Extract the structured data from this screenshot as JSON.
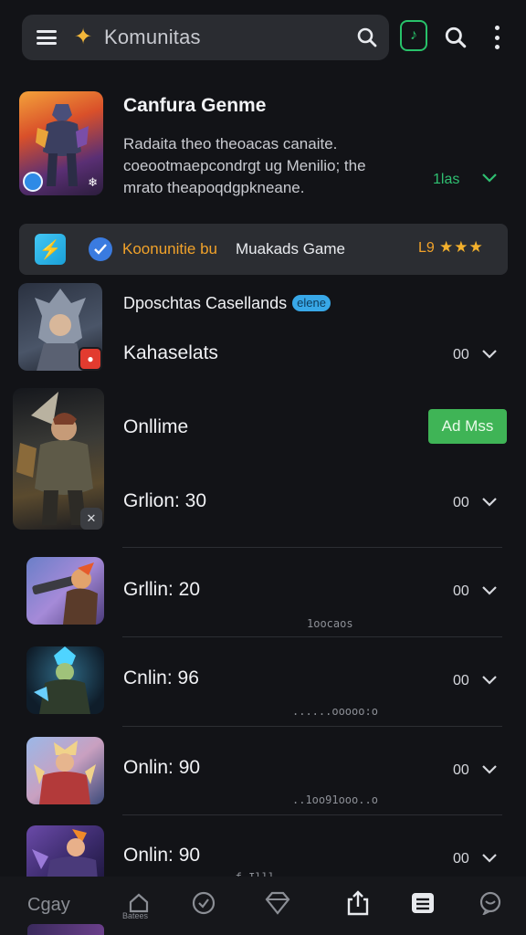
{
  "header": {
    "menu_icon": "hamburger-icon",
    "logo_icon": "star-logo-icon",
    "title": "Komunitas",
    "icons": [
      "search-icon",
      "music-note-icon",
      "search-icon",
      "more-vertical-icon"
    ]
  },
  "featured": {
    "title": "Canfura Genme",
    "description": "Radaita theo theoacas canaite. coeootmaepcondrgt ug Menilio; the mrato theapoqdgpkneane.",
    "meta": "1las"
  },
  "banner": {
    "highlight": "Koonunitie bu",
    "text": "Muakads Game",
    "rating": "L9",
    "stars": "★★★"
  },
  "rows": [
    {
      "title": "Dposchtas Casellands",
      "tag": "elene",
      "label": "Kahaselats",
      "count": "00"
    },
    {
      "title": "Onllime",
      "action": "Ad Mss",
      "label": "Grlion: 30",
      "count": "00"
    },
    {
      "label": "Grllin: 20",
      "count": "00",
      "sub": "1oocaos"
    },
    {
      "label": "Cnlin: 96",
      "count": "00",
      "sub": "......ooooo:o"
    },
    {
      "label": "Onlin: 90",
      "count": "00",
      "sub": "..1oo91ooo..o"
    },
    {
      "label": "Onlin: 90",
      "count": "00",
      "sub": "...f Illl"
    }
  ],
  "bottom_nav": {
    "left_label": "Cgay",
    "home_sub": "Batees",
    "icons": [
      "home-icon",
      "check-circle-icon",
      "diamond-icon",
      "share-icon",
      "list-icon",
      "chat-icon"
    ]
  },
  "colors": {
    "background": "#121317",
    "accent_green": "#3fb456",
    "accent_orange": "#f1a22a",
    "check_blue": "#3a7be0"
  }
}
